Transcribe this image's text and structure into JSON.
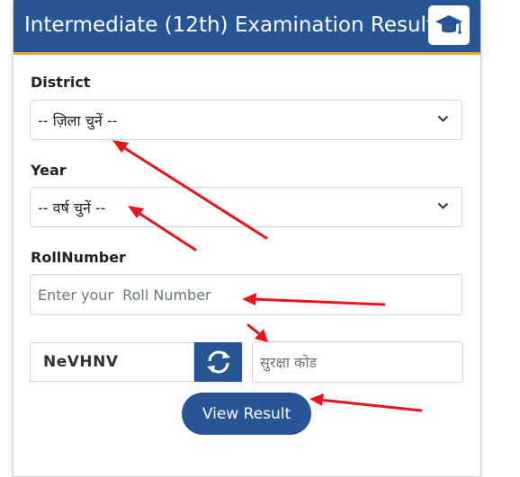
{
  "header": {
    "title": "Intermediate (12th) Examination Result",
    "icon": "graduation-cap-icon"
  },
  "form": {
    "district_label": "District",
    "district_selected": "-- ज़िला चुनें --",
    "year_label": "Year",
    "year_selected": "-- वर्ष चुनें --",
    "rollnumber_label": "RollNumber",
    "rollnumber_placeholder": "Enter your  Roll Number",
    "rollnumber_value": "",
    "captcha_code": "NeVHNV",
    "captcha_input_placeholder": "सुरक्षा कोड",
    "captcha_input_value": "",
    "submit_label": "View Result"
  },
  "colors": {
    "header_bg": "#285593",
    "header_underline": "#f0a62b",
    "button_bg": "#285593",
    "annotation_arrow": "#e8141b"
  }
}
